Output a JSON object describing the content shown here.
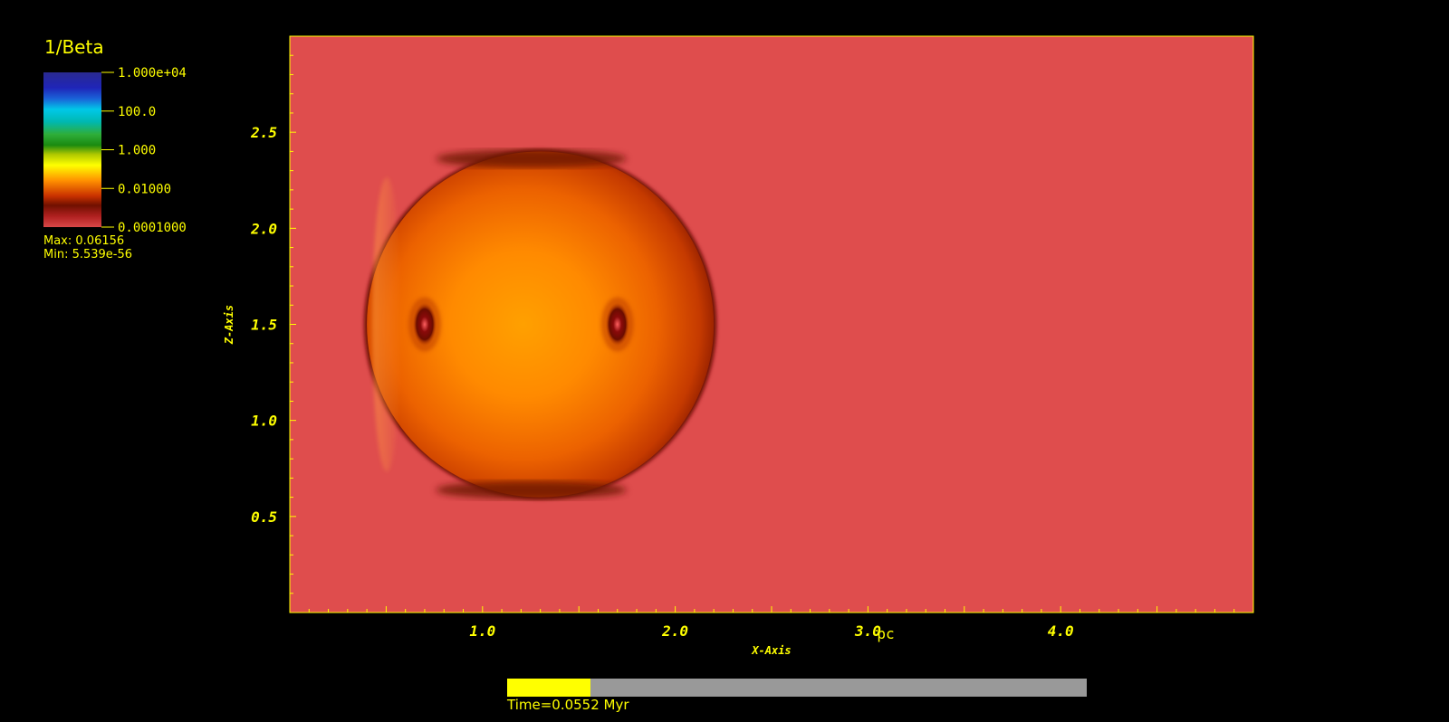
{
  "legend": {
    "title": "1/Beta",
    "ticks": [
      "1.000e+04",
      "100.0",
      "1.000",
      "0.01000",
      "0.0001000"
    ],
    "max_text": "Max:  0.06156",
    "min_text": "Min:  5.539e-56"
  },
  "time": {
    "label": "Time=0.0552 Myr",
    "progress_fraction": 0.144
  },
  "colors": {
    "text": "#ffff00",
    "background": "#000000",
    "ambient": "#df4d4d",
    "time_track": "#999999"
  },
  "chart_data": {
    "type": "heatmap",
    "title": "",
    "xlabel": "X-Axis",
    "ylabel": "Z-Axis",
    "unit": "pc",
    "xlim": [
      0.0,
      5.0
    ],
    "ylim": [
      0.0,
      3.0
    ],
    "x_ticks": [
      "1.0",
      "2.0",
      "3.0",
      "4.0"
    ],
    "y_ticks": [
      "0.5",
      "1.0",
      "1.5",
      "2.0",
      "2.5"
    ],
    "colorbar": {
      "label": "1/Beta",
      "scale": "log",
      "range": [
        0.0001,
        10000
      ]
    },
    "max_value": 0.06156,
    "min_value": 5.539e-56,
    "features": {
      "bubble_center": [
        1.2,
        1.5
      ],
      "bubble_x_range": [
        0.4,
        2.2
      ],
      "bubble_z_range": [
        0.6,
        2.4
      ],
      "dark_spots": [
        [
          0.7,
          1.5
        ],
        [
          1.7,
          1.5
        ]
      ]
    }
  }
}
